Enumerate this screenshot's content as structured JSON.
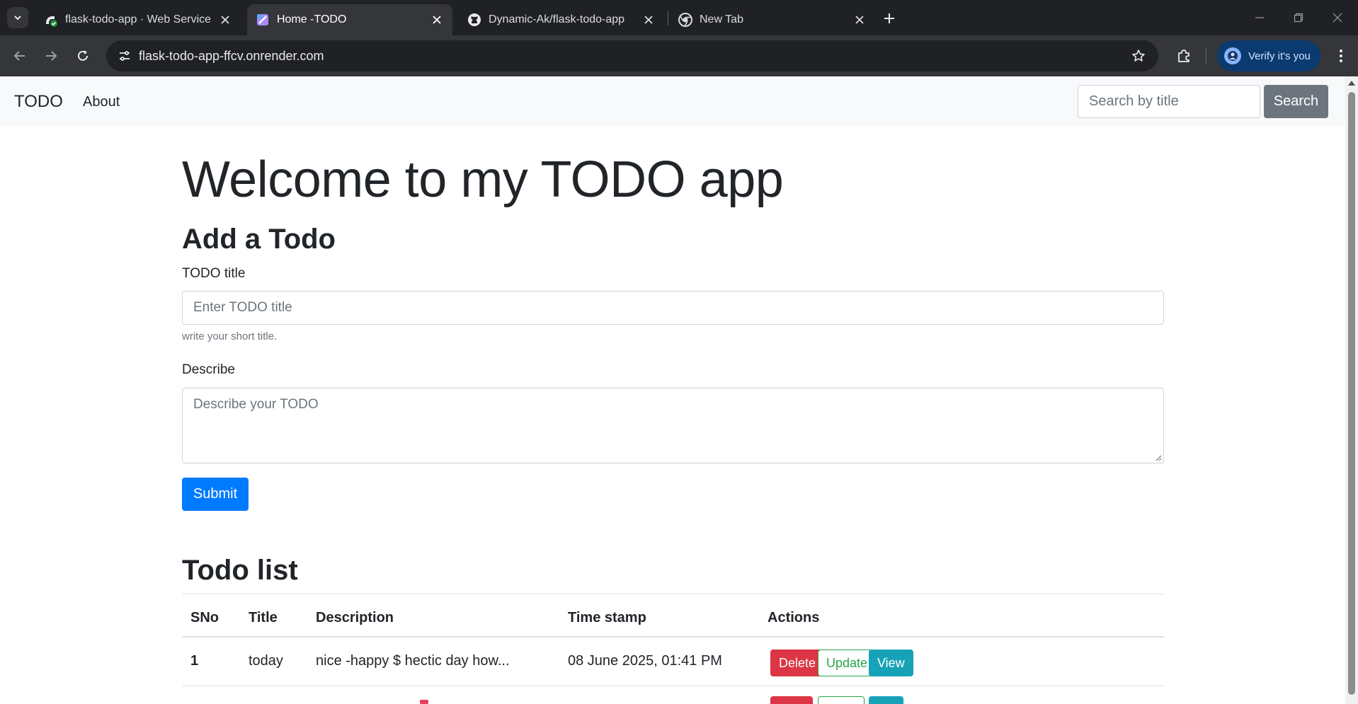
{
  "browser": {
    "tabs": [
      {
        "title": "flask-todo-app · Web Service ·",
        "active": false,
        "favicon": "render-favicon-icon"
      },
      {
        "title": "Home -TODO",
        "active": true,
        "favicon": "app-favicon-icon"
      },
      {
        "title": "Dynamic-Ak/flask-todo-app",
        "active": false,
        "favicon": "github-icon"
      },
      {
        "title": "New Tab",
        "active": false,
        "favicon": "chrome-icon"
      }
    ],
    "url": "flask-todo-app-ffcv.onrender.com",
    "verify_label": "Verify it's you"
  },
  "navbar": {
    "brand": "TODO",
    "about": "About",
    "search_placeholder": "Search by title",
    "search_button": "Search"
  },
  "main": {
    "welcome": "Welcome to my TODO app",
    "add_heading": "Add a Todo",
    "title_label": "TODO title",
    "title_placeholder": "Enter TODO title",
    "title_help": "write your short title.",
    "desc_label": "Describe",
    "desc_placeholder": "Describe your TODO",
    "submit": "Submit",
    "list_heading": "Todo list"
  },
  "table": {
    "headers": [
      "SNo",
      "Title",
      "Description",
      "Time stamp",
      "Actions"
    ],
    "rows": [
      {
        "sno": "1",
        "title": "today",
        "description": "nice -happy $ hectic day how...",
        "timestamp": "08 June 2025, 01:41 PM"
      }
    ],
    "actions": {
      "delete": "Delete",
      "update": "Update",
      "view": "View"
    }
  },
  "colors": {
    "primary": "#007bff",
    "danger": "#dc3545",
    "success": "#28a745",
    "info": "#17a2b8",
    "secondary": "#6c757d"
  }
}
